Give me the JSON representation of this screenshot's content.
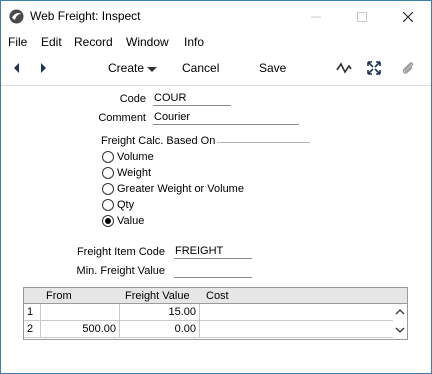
{
  "window": {
    "title": "Web Freight: Inspect"
  },
  "menu": [
    "File",
    "Edit",
    "Record",
    "Window",
    "Info"
  ],
  "toolbar": {
    "create_label": "Create",
    "cancel_label": "Cancel",
    "save_label": "Save"
  },
  "form": {
    "code_label": "Code",
    "code_value": "COUR",
    "comment_label": "Comment",
    "comment_value": "Courier",
    "calc_group_label": "Freight Calc. Based On",
    "calc_options": [
      "Volume",
      "Weight",
      "Greater Weight or Volume",
      "Qty",
      "Value"
    ],
    "calc_selected": "Value",
    "item_code_label": "Freight Item Code",
    "item_code_value": "FREIGHT",
    "min_value_label": "Min. Freight Value",
    "min_value_value": ""
  },
  "grid": {
    "columns": [
      "From",
      "Freight Value",
      "Cost"
    ],
    "rows": [
      {
        "num": "1",
        "from": "",
        "value": "15.00",
        "cost": ""
      },
      {
        "num": "2",
        "from": "500.00",
        "value": "0.00",
        "cost": ""
      }
    ]
  },
  "colors": {
    "window_border": "#3c7fb1",
    "grid_header_bg": "#e6e6e6"
  }
}
